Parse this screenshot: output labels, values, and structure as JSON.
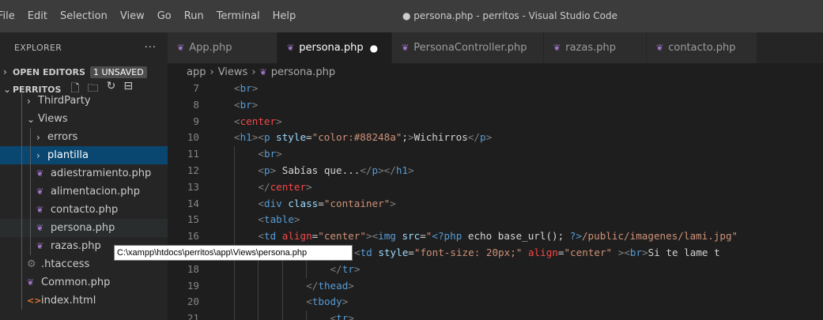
{
  "menu": [
    "File",
    "Edit",
    "Selection",
    "View",
    "Go",
    "Run",
    "Terminal",
    "Help"
  ],
  "window_title": "● persona.php - perritos - Visual Studio Code",
  "explorer": {
    "title": "EXPLORER",
    "more": "···",
    "open_editors": "OPEN EDITORS",
    "unsaved_badge": "1 UNSAVED",
    "project": "PERRITOS"
  },
  "tree": [
    {
      "label": "ThirdParty",
      "type": "folder",
      "indent": 1,
      "open": false
    },
    {
      "label": "Views",
      "type": "folder",
      "indent": 1,
      "open": true
    },
    {
      "label": "errors",
      "type": "folder",
      "indent": 2,
      "open": false
    },
    {
      "label": "plantilla",
      "type": "folder",
      "indent": 2,
      "open": false,
      "selected": true
    },
    {
      "label": "adiestramiento.php",
      "type": "php",
      "indent": 2
    },
    {
      "label": "alimentacion.php",
      "type": "php",
      "indent": 2
    },
    {
      "label": "contacto.php",
      "type": "php",
      "indent": 2
    },
    {
      "label": "persona.php",
      "type": "php",
      "indent": 2,
      "hover": true
    },
    {
      "label": "razas.php",
      "type": "php",
      "indent": 2
    },
    {
      "label": ".htaccess",
      "type": "gear",
      "indent": 1
    },
    {
      "label": "Common.php",
      "type": "php",
      "indent": 1
    },
    {
      "label": "index.html",
      "type": "html",
      "indent": 1
    }
  ],
  "tabs": [
    {
      "label": "App.php",
      "active": false
    },
    {
      "label": "persona.php",
      "active": true,
      "dirty": true
    },
    {
      "label": "PersonaController.php",
      "active": false
    },
    {
      "label": "razas.php",
      "active": false
    },
    {
      "label": "contacto.php",
      "active": false
    }
  ],
  "breadcrumb": [
    "app",
    "Views",
    "persona.php"
  ],
  "tooltip": "C:\\xampp\\htdocs\\perritos\\app\\Views\\persona.php",
  "code": [
    {
      "ln": "7",
      "indent": 0,
      "guides": [],
      "parts": [
        [
          "t",
          "<"
        ],
        [
          "tn",
          "br"
        ],
        [
          "t",
          ">"
        ]
      ]
    },
    {
      "ln": "8",
      "indent": 0,
      "guides": [],
      "parts": [
        [
          "t",
          "<"
        ],
        [
          "tn",
          "br"
        ],
        [
          "t",
          ">"
        ]
      ]
    },
    {
      "ln": "9",
      "indent": 0,
      "guides": [],
      "parts": [
        [
          "t",
          "<"
        ],
        [
          "tr",
          "center"
        ],
        [
          "t",
          ">"
        ]
      ]
    },
    {
      "ln": "10",
      "indent": 0,
      "guides": [],
      "parts": [
        [
          "t",
          "<"
        ],
        [
          "tn",
          "h1"
        ],
        [
          "t",
          "><"
        ],
        [
          "tn",
          "p"
        ],
        [
          "tx",
          " "
        ],
        [
          "an",
          "style"
        ],
        [
          "tx",
          "="
        ],
        [
          "st",
          "\"color:#88248a\""
        ],
        [
          "tx",
          ";"
        ],
        [
          "t",
          ">"
        ],
        [
          "tx",
          "Wichirros"
        ],
        [
          "t",
          "</"
        ],
        [
          "tn",
          "p"
        ],
        [
          "t",
          ">"
        ]
      ]
    },
    {
      "ln": "11",
      "indent": 1,
      "guides": [
        0
      ],
      "parts": [
        [
          "t",
          "<"
        ],
        [
          "tn",
          "br"
        ],
        [
          "t",
          ">"
        ]
      ]
    },
    {
      "ln": "12",
      "indent": 1,
      "guides": [
        0
      ],
      "parts": [
        [
          "t",
          "<"
        ],
        [
          "tn",
          "p"
        ],
        [
          "t",
          ">"
        ],
        [
          "tx",
          " Sabías que..."
        ],
        [
          "t",
          "</"
        ],
        [
          "tn",
          "p"
        ],
        [
          "t",
          "></"
        ],
        [
          "tn",
          "h1"
        ],
        [
          "t",
          ">"
        ]
      ]
    },
    {
      "ln": "13",
      "indent": 1,
      "guides": [
        0
      ],
      "parts": [
        [
          "t",
          "</"
        ],
        [
          "tr",
          "center"
        ],
        [
          "t",
          ">"
        ]
      ]
    },
    {
      "ln": "14",
      "indent": 1,
      "guides": [
        0
      ],
      "parts": [
        [
          "t",
          "<"
        ],
        [
          "tn",
          "div"
        ],
        [
          "tx",
          " "
        ],
        [
          "an",
          "class"
        ],
        [
          "tx",
          "="
        ],
        [
          "st",
          "\"container\""
        ],
        [
          "t",
          ">"
        ]
      ]
    },
    {
      "ln": "15",
      "indent": 1,
      "guides": [
        0
      ],
      "parts": [
        [
          "t",
          "<"
        ],
        [
          "tn",
          "table"
        ],
        [
          "t",
          ">"
        ]
      ]
    },
    {
      "ln": "16",
      "indent": 1,
      "guides": [
        0
      ],
      "parts": [
        [
          "t",
          "<"
        ],
        [
          "tn",
          "td"
        ],
        [
          "tx",
          " "
        ],
        [
          "tr",
          "align"
        ],
        [
          "tx",
          "="
        ],
        [
          "st",
          "\"center\""
        ],
        [
          "t",
          "><"
        ],
        [
          "tn",
          "img"
        ],
        [
          "tx",
          " "
        ],
        [
          "an",
          "src"
        ],
        [
          "tx",
          "="
        ],
        [
          "st",
          "\""
        ],
        [
          "ph",
          "<?php"
        ],
        [
          "tx",
          " echo base_url(); "
        ],
        [
          "ph",
          "?>"
        ],
        [
          "st",
          "/public/imagenes/lami.jpg\""
        ]
      ]
    },
    {
      "ln": "17",
      "indent": 5,
      "guides": [
        0,
        1,
        2,
        3,
        4
      ],
      "parts": [
        [
          "t",
          "<"
        ],
        [
          "tn",
          "td"
        ],
        [
          "tx",
          " "
        ],
        [
          "an",
          "style"
        ],
        [
          "tx",
          "="
        ],
        [
          "st",
          "\"font-size: 20px;\""
        ],
        [
          "tx",
          " "
        ],
        [
          "tr",
          "align"
        ],
        [
          "tx",
          "="
        ],
        [
          "st",
          "\"center\""
        ],
        [
          "tx",
          " "
        ],
        [
          "t",
          "><"
        ],
        [
          "tn",
          "br"
        ],
        [
          "t",
          ">"
        ],
        [
          "tx",
          "Si te lame t"
        ]
      ]
    },
    {
      "ln": "18",
      "indent": 4,
      "guides": [
        0,
        1,
        2,
        3
      ],
      "parts": [
        [
          "t",
          "</"
        ],
        [
          "tn",
          "tr"
        ],
        [
          "t",
          ">"
        ]
      ]
    },
    {
      "ln": "19",
      "indent": 3,
      "guides": [
        0,
        1,
        2
      ],
      "parts": [
        [
          "t",
          "</"
        ],
        [
          "tn",
          "thead"
        ],
        [
          "t",
          ">"
        ]
      ]
    },
    {
      "ln": "20",
      "indent": 3,
      "guides": [
        0,
        1,
        2
      ],
      "parts": [
        [
          "t",
          "<"
        ],
        [
          "tn",
          "tbody"
        ],
        [
          "t",
          ">"
        ]
      ]
    },
    {
      "ln": "21",
      "indent": 4,
      "guides": [
        0,
        1,
        2,
        3
      ],
      "parts": [
        [
          "t",
          "<"
        ],
        [
          "tn",
          "tr"
        ],
        [
          "t",
          ">"
        ]
      ]
    }
  ],
  "colors": {
    "titlebar": "#3c3c3c",
    "sidebar": "#252526",
    "editor": "#1e1e1e",
    "selected": "#094771",
    "php_icon": "#a074c4"
  },
  "icons": {
    "file_type": "php-elephant-icon",
    "new_file": "new-file-icon",
    "new_folder": "new-folder-icon",
    "refresh": "refresh-icon",
    "collapse": "collapse-all-icon"
  }
}
